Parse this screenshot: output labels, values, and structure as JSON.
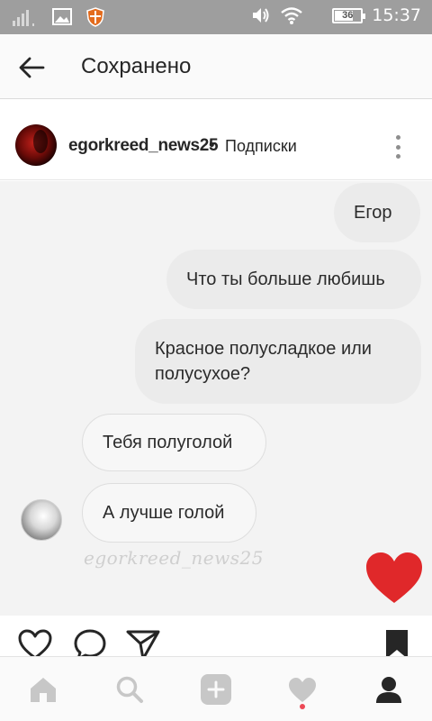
{
  "status_bar": {
    "battery_level": "36",
    "time": "15:37"
  },
  "header": {
    "title": "Сохранено"
  },
  "post": {
    "username": "egorkreed_news25",
    "separator": "•",
    "follow_label": "Подписки",
    "image": {
      "messages": [
        {
          "side": "outgoing",
          "text": "Егор"
        },
        {
          "side": "outgoing",
          "text": "Что ты больше любишь"
        },
        {
          "side": "outgoing",
          "text": "Красное полусладкое или полусухое?"
        },
        {
          "side": "incoming",
          "text": "Тебя полуголой"
        },
        {
          "side": "incoming",
          "text": "А лучше голой"
        }
      ],
      "watermark": "egorkreed_news25"
    }
  },
  "colors": {
    "status_bar": "#9e9e9e",
    "heart": "#e0282a",
    "notification_dot": "#ed4956",
    "inactive_nav": "#c7c7c7",
    "active_nav": "#262626"
  },
  "icons": {
    "back": "arrow-left-icon",
    "more": "more-vertical-icon",
    "like": "heart-outline-icon",
    "comment": "comment-icon",
    "share": "paper-plane-icon",
    "save": "bookmark-icon",
    "nav": [
      "home-icon",
      "search-icon",
      "add-icon",
      "heart-icon",
      "profile-icon"
    ]
  }
}
